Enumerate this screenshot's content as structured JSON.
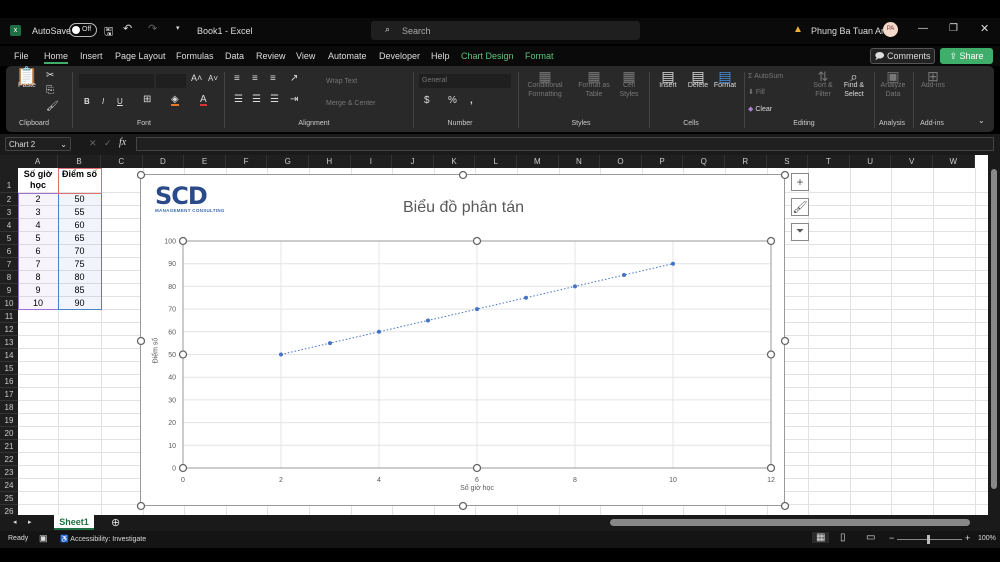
{
  "titlebar": {
    "autosave_label": "AutoSave",
    "autosave_state": "Off",
    "doc_title": "Book1 - Excel",
    "search_placeholder": "Search",
    "user_name": "Phung Ba Tuan Anh",
    "user_initials": "PA"
  },
  "menu": {
    "items": [
      "File",
      "Home",
      "Insert",
      "Page Layout",
      "Formulas",
      "Data",
      "Review",
      "View",
      "Automate",
      "Developer",
      "Help"
    ],
    "context_items": [
      "Chart Design",
      "Format"
    ],
    "active": "Home",
    "comments_label": "Comments",
    "share_label": "Share"
  },
  "ribbon": {
    "clipboard": {
      "paste": "Paste",
      "label": "Clipboard"
    },
    "font": {
      "label": "Font",
      "bold": "B",
      "italic": "I",
      "underline": "U"
    },
    "alignment": {
      "wrap_text": "Wrap Text",
      "merge_center": "Merge & Center",
      "label": "Alignment"
    },
    "number": {
      "format": "General",
      "label": "Number"
    },
    "styles": {
      "conditional": "Conditional Formatting",
      "format_table": "Format as Table",
      "cell_styles": "Cell Styles",
      "label": "Styles"
    },
    "cells": {
      "insert": "Insert",
      "delete": "Delete",
      "format": "Format",
      "label": "Cells"
    },
    "editing": {
      "autosum": "AutoSum",
      "fill": "Fill",
      "clear": "Clear",
      "sort_filter": "Sort & Filter",
      "find_select": "Find & Select",
      "label": "Editing"
    },
    "analysis": {
      "analyze": "Analyze Data",
      "label": "Analysis"
    },
    "addins": {
      "addins": "Add-ins",
      "label": "Add-ins"
    }
  },
  "formula_bar": {
    "name_box": "Chart 2",
    "fx": "fx",
    "value": ""
  },
  "columns": [
    "A",
    "B",
    "C",
    "D",
    "E",
    "F",
    "G",
    "H",
    "I",
    "J",
    "K",
    "L",
    "M",
    "N",
    "O",
    "P",
    "Q",
    "R",
    "S",
    "T",
    "U",
    "V",
    "W"
  ],
  "table": {
    "headers": [
      "Số giờ học",
      "Điểm số"
    ],
    "rows": [
      [
        "2",
        "50"
      ],
      [
        "3",
        "55"
      ],
      [
        "4",
        "60"
      ],
      [
        "5",
        "65"
      ],
      [
        "6",
        "70"
      ],
      [
        "7",
        "75"
      ],
      [
        "8",
        "80"
      ],
      [
        "9",
        "85"
      ],
      [
        "10",
        "90"
      ]
    ]
  },
  "chart_data": {
    "type": "scatter",
    "title": "Biểu đồ phân tán",
    "xlabel": "Số giờ học",
    "ylabel": "Điểm số",
    "x": [
      2,
      3,
      4,
      5,
      6,
      7,
      8,
      9,
      10
    ],
    "y": [
      50,
      55,
      60,
      65,
      70,
      75,
      80,
      85,
      90
    ],
    "xlim": [
      0,
      12
    ],
    "ylim": [
      0,
      100
    ],
    "xticks": [
      "0",
      "2",
      "4",
      "6",
      "8",
      "10",
      "12"
    ],
    "yticks": [
      "0",
      "10",
      "20",
      "30",
      "40",
      "50",
      "60",
      "70",
      "80",
      "90",
      "100"
    ],
    "trendline": "linear dotted",
    "grid": true,
    "color": "#4472c4"
  },
  "logo": {
    "text": "SCD",
    "subtitle": "MANAGEMENT CONSULTING"
  },
  "sheet_tabs": {
    "tabs": [
      "Sheet1"
    ],
    "active": "Sheet1"
  },
  "status": {
    "ready": "Ready",
    "accessibility": "Accessibility: Investigate",
    "zoom": "100%",
    "zoom_level": 100
  }
}
